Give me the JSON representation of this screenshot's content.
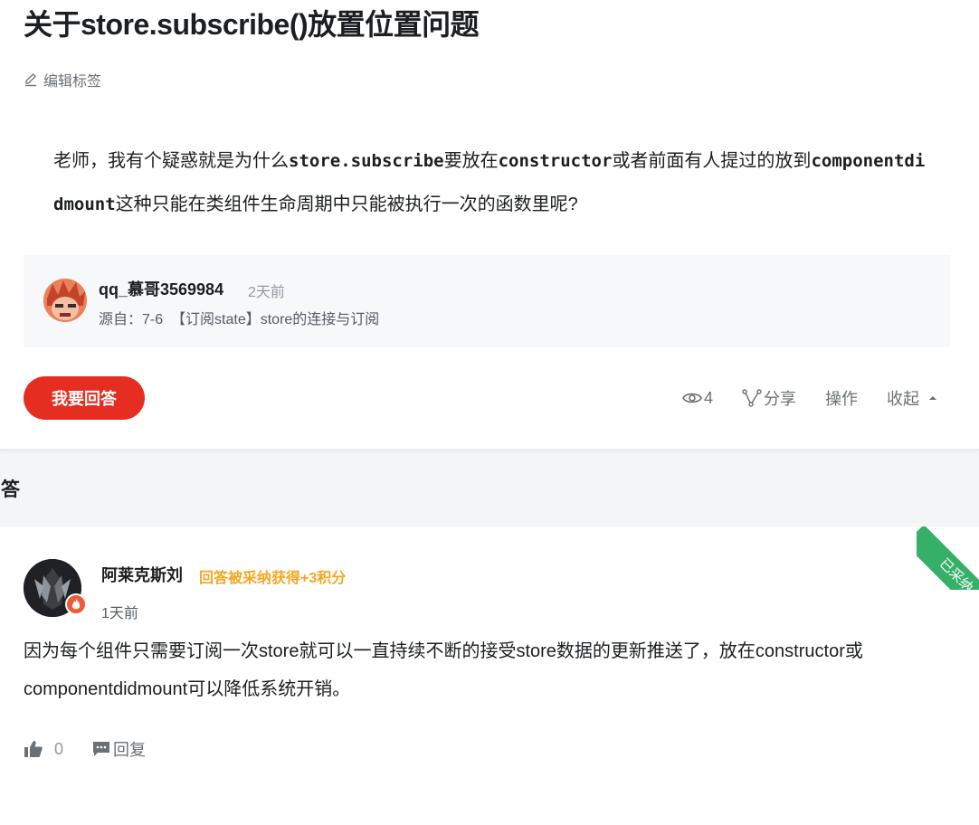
{
  "question": {
    "title": "关于store.subscribe()放置位置问题",
    "edit_tags_label": "编辑标签",
    "body_parts": [
      {
        "t": "text",
        "v": "老师，我有个疑惑就是为什么"
      },
      {
        "t": "code",
        "v": "store.subscribe"
      },
      {
        "t": "text",
        "v": "要放在"
      },
      {
        "t": "code",
        "v": "constructor"
      },
      {
        "t": "text",
        "v": "或者前面有人提过的放到"
      },
      {
        "t": "code",
        "v": "componentdidmount"
      },
      {
        "t": "text",
        "v": "这种只能在类组件生命周期中只能被执行一次的函数里呢?"
      }
    ],
    "asker": {
      "name": "qq_慕哥3569984",
      "time": "2天前",
      "source_prefix": "源自：7-6",
      "source_link": "【订阅state】store的连接与订阅"
    }
  },
  "actions": {
    "answer_button": "我要回答",
    "views_count": "4",
    "share_label": "分享",
    "operate_label": "操作",
    "collapse_label": "收起"
  },
  "answers_section": {
    "title": "回答"
  },
  "answer": {
    "adopted_badge": "已采纳",
    "author": "阿莱克斯刘",
    "bonus": "回答被采纳获得+3积分",
    "time": "1天前",
    "body": "因为每个组件只需要订阅一次store就可以一直持续不断的接受store数据的更新推送了，放在constructor或componentdidmount可以降低系统开销。",
    "likes": "0",
    "reply_label": "回复"
  },
  "colors": {
    "primary_red": "#e52e21",
    "adopted_green": "#36b068",
    "bonus_orange": "#f5a623"
  }
}
